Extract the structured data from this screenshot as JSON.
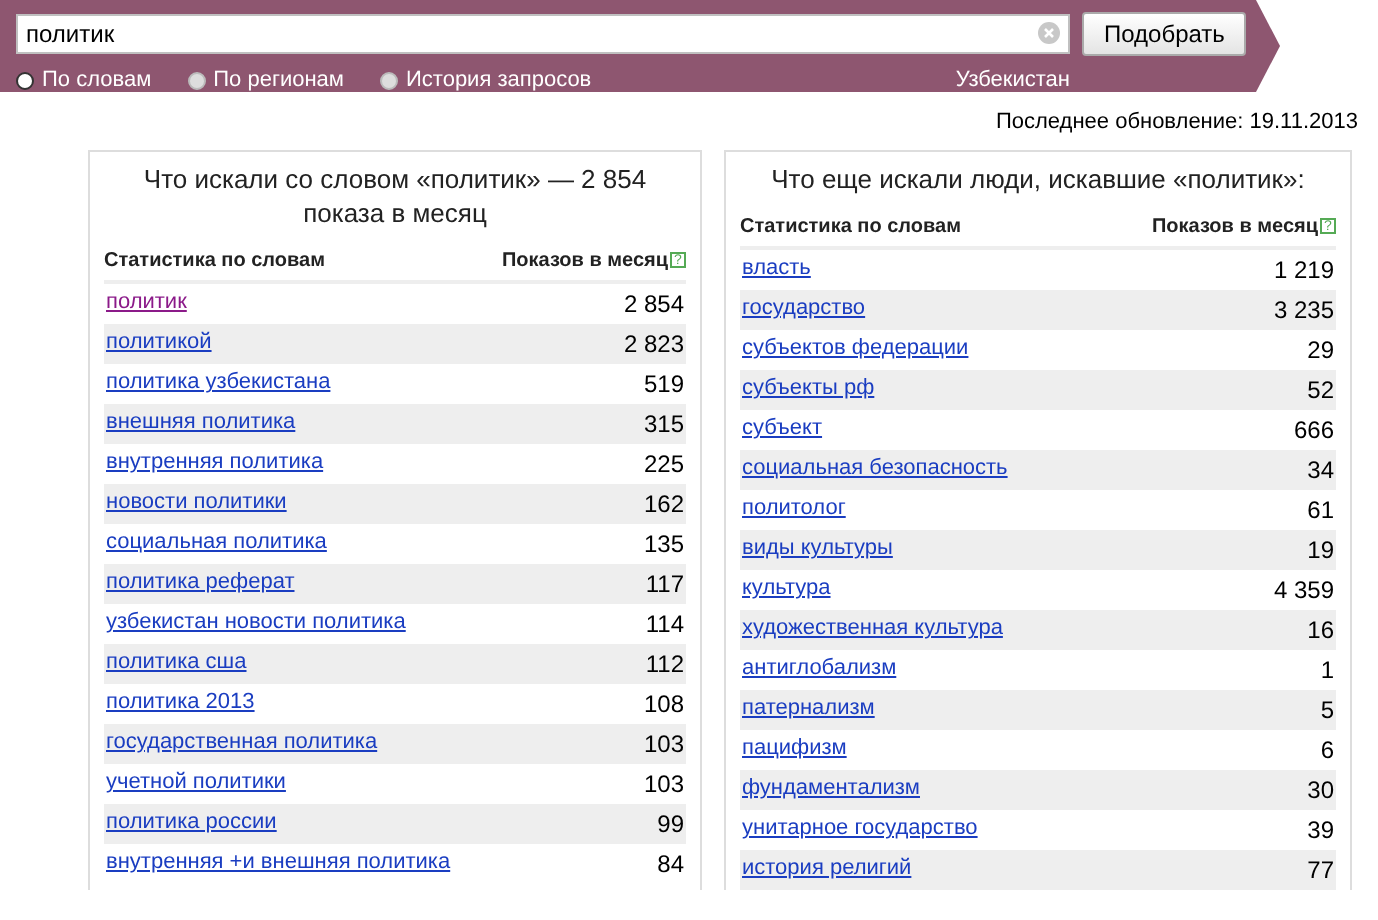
{
  "search": {
    "value": "политик",
    "button": "Подобрать"
  },
  "modes": [
    {
      "label": "По словам",
      "selected": true
    },
    {
      "label": "По регионам",
      "selected": false
    },
    {
      "label": "История запросов",
      "selected": false
    }
  ],
  "region": "Узбекистан",
  "last_update": "Последнее обновление: 19.11.2013",
  "panels": [
    {
      "title": "Что искали со словом «политик» — 2 854 показа в месяц",
      "columns": [
        "Статистика по словам",
        "Показов в месяц"
      ],
      "help": "?",
      "rows": [
        {
          "phrase": "политик",
          "count": "2 854",
          "visited": true
        },
        {
          "phrase": "политикой",
          "count": "2 823",
          "visited": false
        },
        {
          "phrase": "политика узбекистана",
          "count": "519",
          "visited": false
        },
        {
          "phrase": "внешняя политика",
          "count": "315",
          "visited": false
        },
        {
          "phrase": "внутренняя политика",
          "count": "225",
          "visited": false
        },
        {
          "phrase": "новости политики",
          "count": "162",
          "visited": false
        },
        {
          "phrase": "социальная политика",
          "count": "135",
          "visited": false
        },
        {
          "phrase": "политика реферат",
          "count": "117",
          "visited": false
        },
        {
          "phrase": "узбекистан новости политика",
          "count": "114",
          "visited": false
        },
        {
          "phrase": "политика сша",
          "count": "112",
          "visited": false
        },
        {
          "phrase": "политика 2013",
          "count": "108",
          "visited": false
        },
        {
          "phrase": "государственная политика",
          "count": "103",
          "visited": false
        },
        {
          "phrase": "учетной политики",
          "count": "103",
          "visited": false
        },
        {
          "phrase": "политика россии",
          "count": "99",
          "visited": false
        },
        {
          "phrase": "внутренняя +и внешняя политика",
          "count": "84",
          "visited": false
        }
      ]
    },
    {
      "title": "Что еще искали люди, искавшие «политик»:",
      "columns": [
        "Статистика по словам",
        "Показов в месяц"
      ],
      "help": "?",
      "rows": [
        {
          "phrase": "власть",
          "count": "1 219",
          "visited": false
        },
        {
          "phrase": "государство",
          "count": "3 235",
          "visited": false
        },
        {
          "phrase": "субъектов федерации",
          "count": "29",
          "visited": false
        },
        {
          "phrase": "субъекты рф",
          "count": "52",
          "visited": false
        },
        {
          "phrase": "субъект",
          "count": "666",
          "visited": false
        },
        {
          "phrase": "социальная безопасность",
          "count": "34",
          "visited": false
        },
        {
          "phrase": "политолог",
          "count": "61",
          "visited": false
        },
        {
          "phrase": "виды культуры",
          "count": "19",
          "visited": false
        },
        {
          "phrase": "культура",
          "count": "4 359",
          "visited": false
        },
        {
          "phrase": "художественная культура",
          "count": "16",
          "visited": false
        },
        {
          "phrase": "антиглобализм",
          "count": "1",
          "visited": false
        },
        {
          "phrase": "патернализм",
          "count": "5",
          "visited": false
        },
        {
          "phrase": "пацифизм",
          "count": "6",
          "visited": false
        },
        {
          "phrase": "фундаментализм",
          "count": "30",
          "visited": false
        },
        {
          "phrase": "унитарное государство",
          "count": "39",
          "visited": false
        },
        {
          "phrase": "история религий",
          "count": "77",
          "visited": false
        }
      ]
    }
  ]
}
